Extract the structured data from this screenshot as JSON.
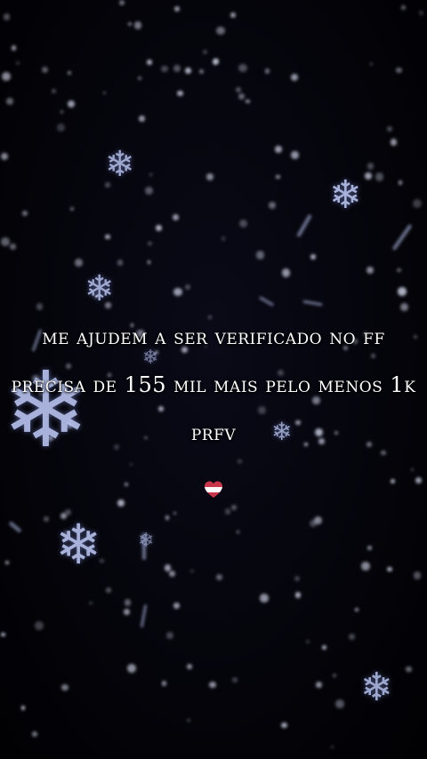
{
  "caption": {
    "lines": [
      "me ajudem a ser verificado no ff",
      "precisa de 155 mil mais pelo menos 1k",
      "prfv"
    ]
  },
  "emoji": {
    "name": "heart-icon"
  },
  "colors": {
    "background": "#020209",
    "text": "#ffffff",
    "snowflake": "#b9c4f0",
    "heart_red": "#c8384a",
    "heart_white": "#ffffff"
  }
}
